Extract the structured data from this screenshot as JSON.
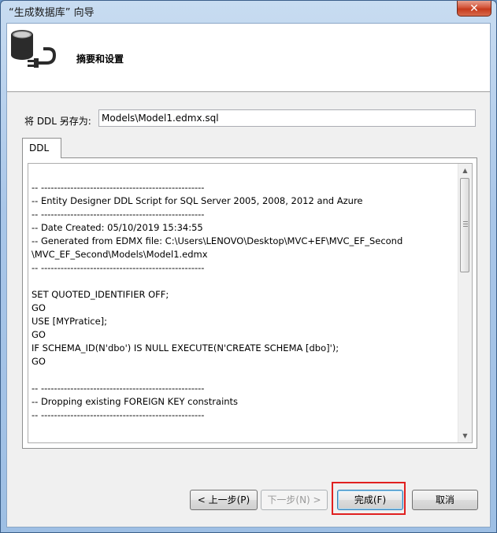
{
  "window": {
    "title": "“生成数据库” 向导",
    "close_label": "✕"
  },
  "header": {
    "title": "摘要和设置",
    "icon": "database-plug-icon"
  },
  "save_as": {
    "label": "将 DDL 另存为:",
    "value": "Models\\Model1.edmx.sql"
  },
  "tabs": [
    {
      "label": "DDL",
      "selected": true
    }
  ],
  "ddl_script": "-- --------------------------------------------------\n-- Entity Designer DDL Script for SQL Server 2005, 2008, 2012 and Azure\n-- --------------------------------------------------\n-- Date Created: 05/10/2019 15:34:55\n-- Generated from EDMX file: C:\\Users\\LENOVO\\Desktop\\MVC+EF\\MVC_EF_Second\n\\MVC_EF_Second\\Models\\Model1.edmx\n-- --------------------------------------------------\n\nSET QUOTED_IDENTIFIER OFF;\nGO\nUSE [MYPratice];\nGO\nIF SCHEMA_ID(N'dbo') IS NULL EXECUTE(N'CREATE SCHEMA [dbo]');\nGO\n\n-- --------------------------------------------------\n-- Dropping existing FOREIGN KEY constraints\n-- --------------------------------------------------",
  "buttons": {
    "prev": "< 上一步(P)",
    "next": "下一步(N) >",
    "finish": "完成(F)",
    "cancel": "取消"
  },
  "colors": {
    "highlight": "#e02020",
    "title_bar": "#a9c6e8",
    "close_button": "#c53a1c"
  }
}
